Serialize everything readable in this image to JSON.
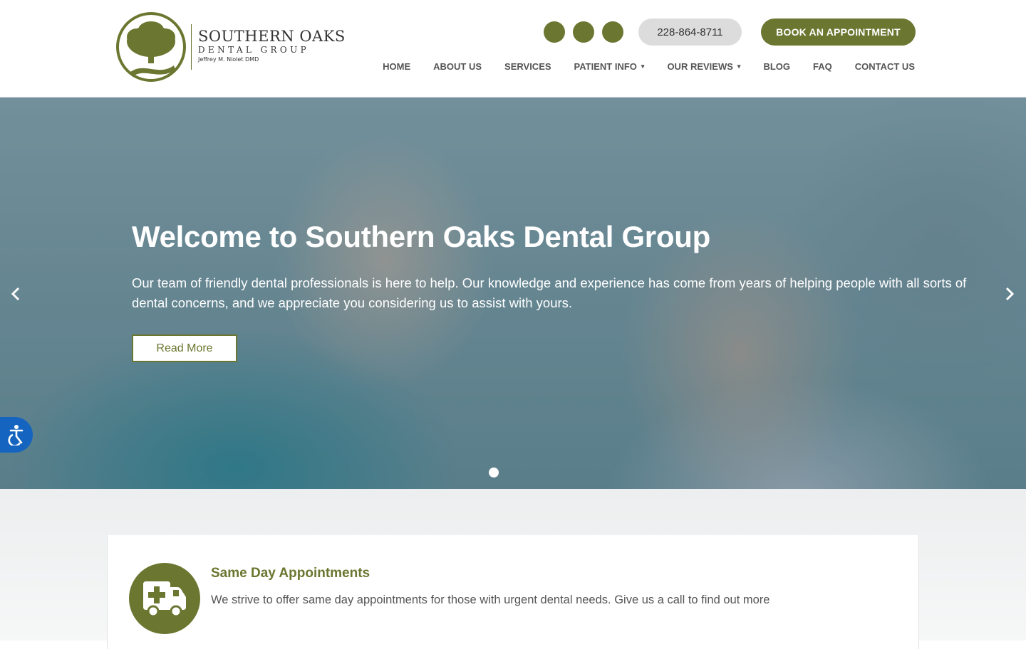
{
  "brand": {
    "name": "SOUTHERN OAKS",
    "subtitle": "DENTAL GROUP",
    "doctor": "Jeffrey M. Niolet DMD",
    "accent_color": "#6b7730"
  },
  "header": {
    "social_icons": [
      "social-icon",
      "social-icon",
      "social-icon"
    ],
    "phone": "228-864-8711",
    "book_label": "BOOK AN APPOINTMENT"
  },
  "nav": {
    "items": [
      {
        "label": "HOME"
      },
      {
        "label": "ABOUT US"
      },
      {
        "label": "SERVICES"
      },
      {
        "label": "PATIENT INFO",
        "caret": "▾"
      },
      {
        "label": "OUR REVIEWS",
        "caret": "▾"
      },
      {
        "label": "BLOG"
      },
      {
        "label": "FAQ"
      },
      {
        "label": "CONTACT US"
      }
    ]
  },
  "hero": {
    "title": "Welcome to Southern Oaks Dental Group",
    "text": "Our team of friendly dental professionals is here to help. Our knowledge and experience has come from years of helping people with all sorts of dental concerns, and we appreciate you considering us to assist with yours.",
    "button_label": "Read More",
    "prev_icon": "chevron-left-icon",
    "next_icon": "chevron-right-icon"
  },
  "accessibility": {
    "icon": "accessibility-icon",
    "color": "#1565c0"
  },
  "feature": {
    "icon": "ambulance-icon",
    "title": "Same Day Appointments",
    "text": "We strive to offer same day appointments for those with urgent dental needs. Give us a call to find out more"
  }
}
